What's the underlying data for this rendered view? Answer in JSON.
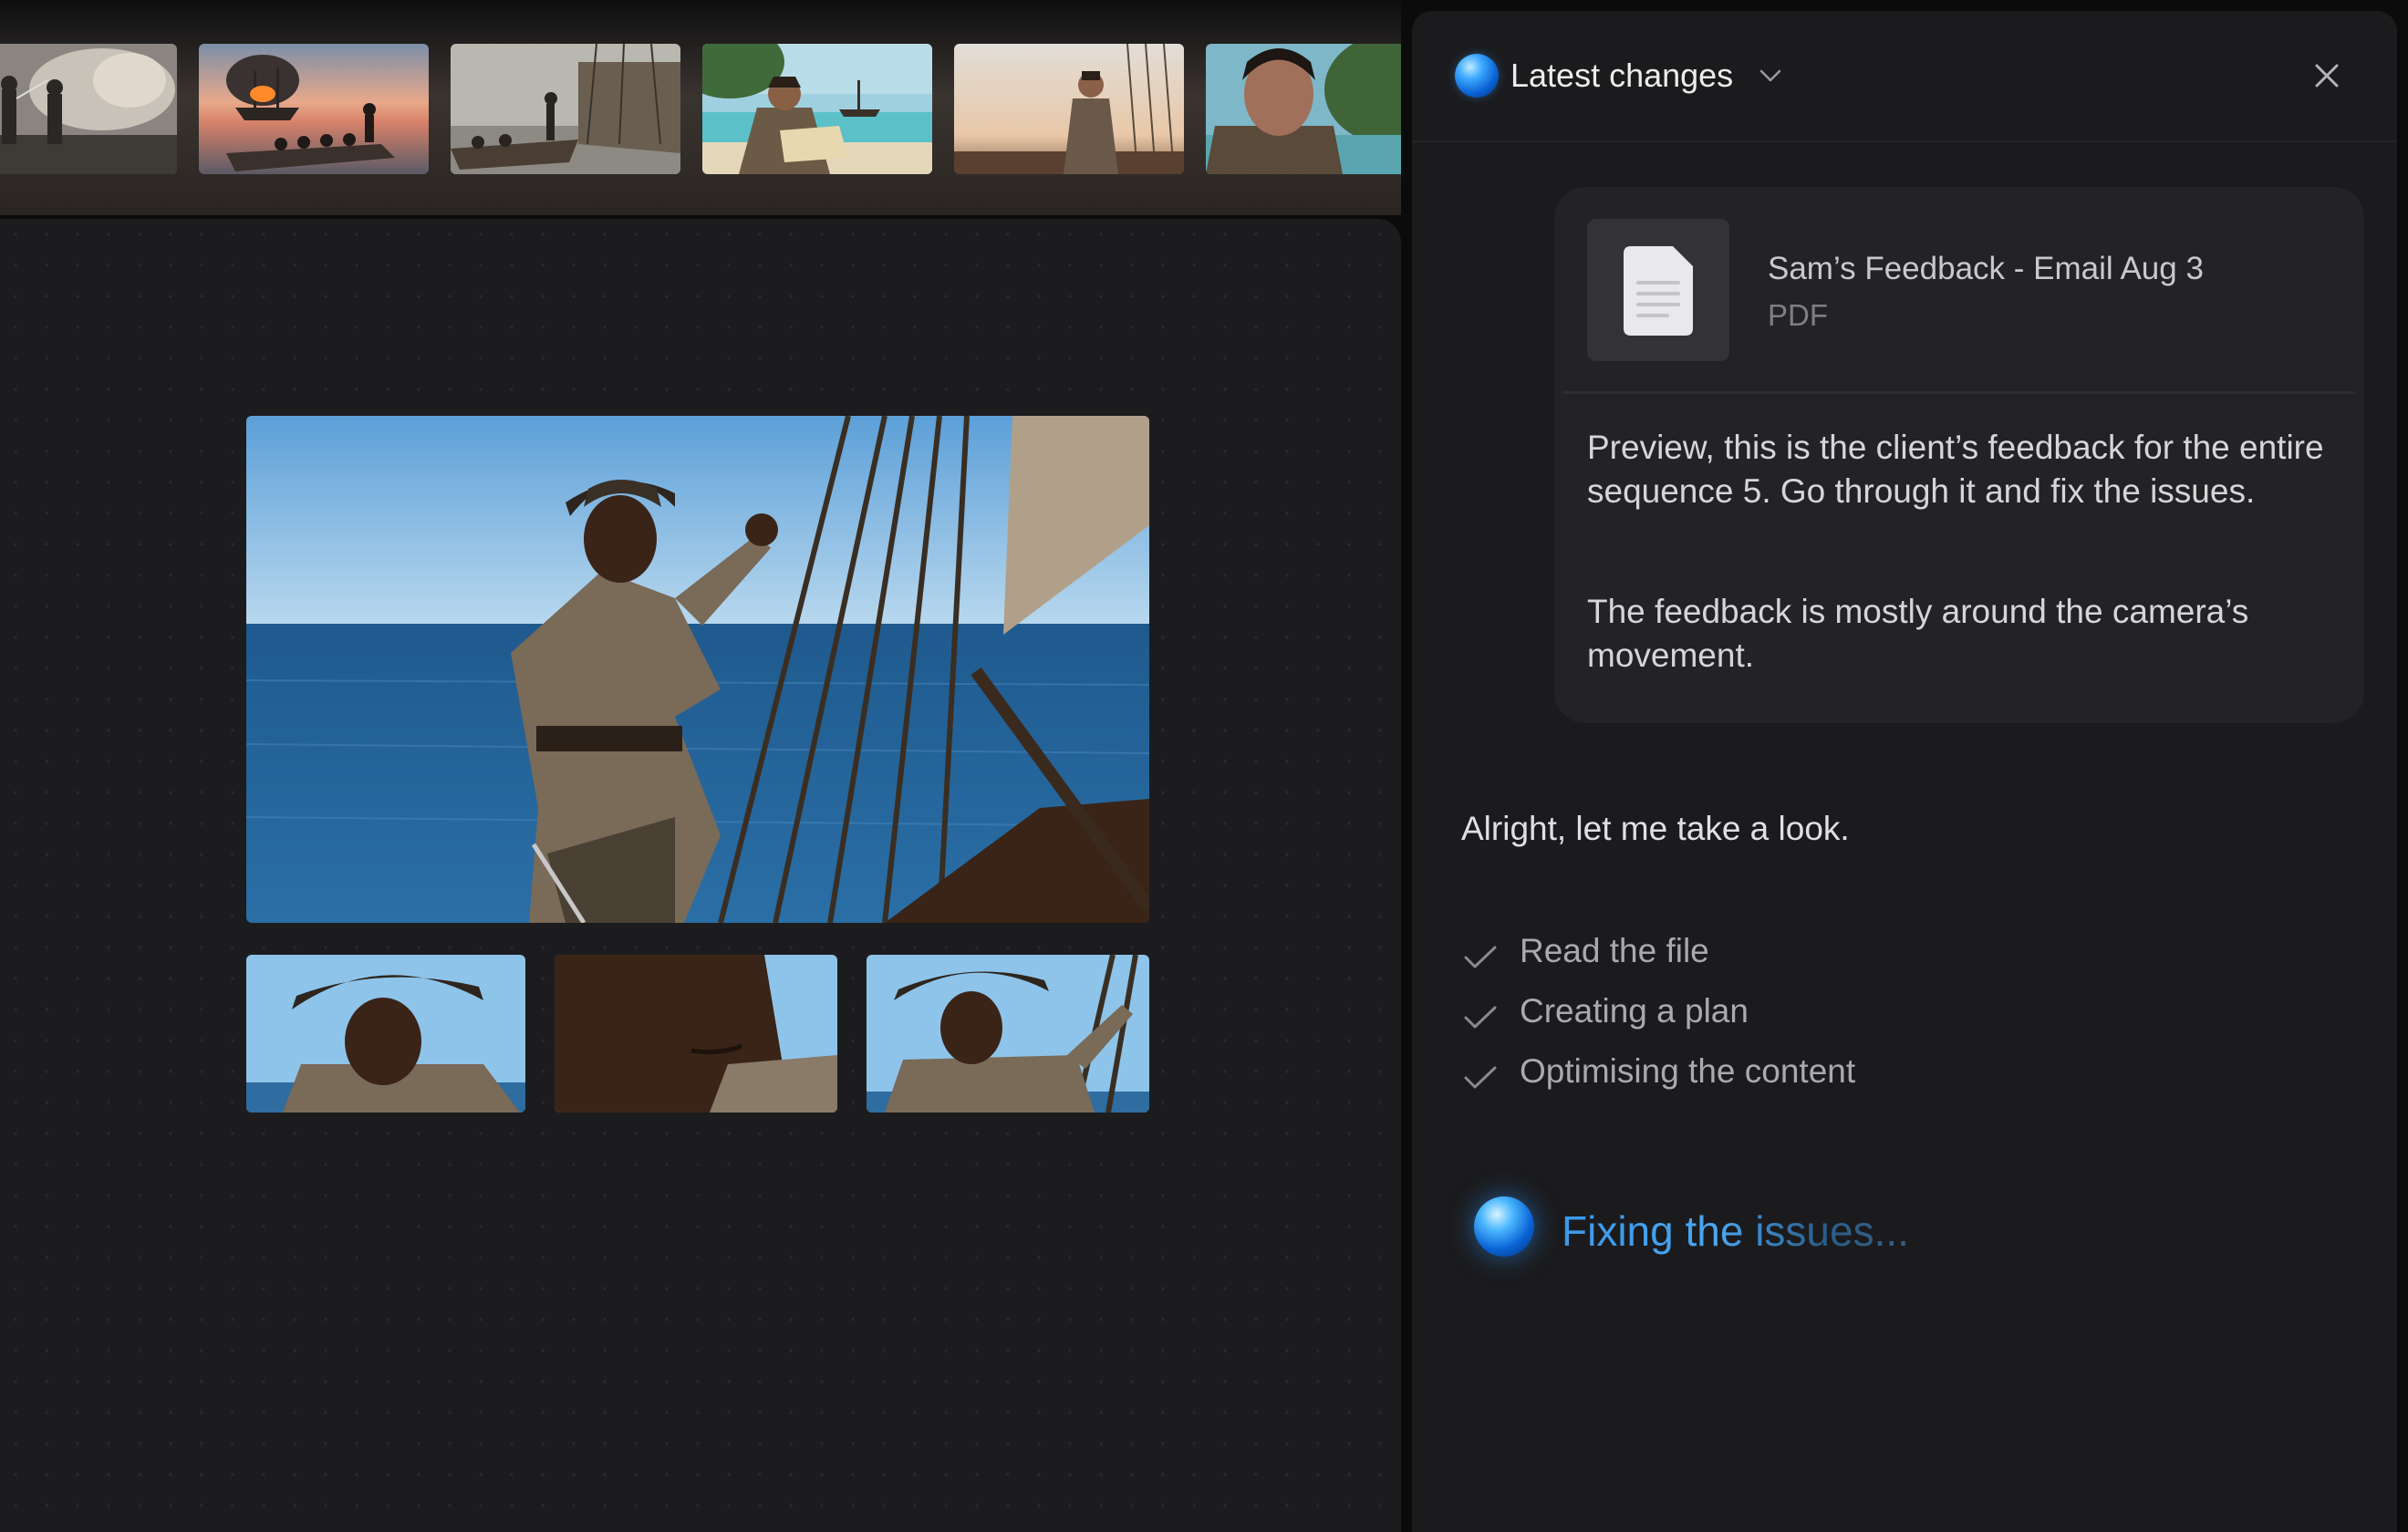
{
  "panel": {
    "title": "Latest changes",
    "attachment": {
      "file_name": "Sam’s Feedback - Email Aug 3",
      "file_type": "PDF"
    },
    "message": {
      "paragraph_1": "Preview, this is the client’s feedback for the entire sequence 5. Go through it and fix the issues.",
      "paragraph_2": "The feedback is mostly around the camera’s movement."
    },
    "reply": "Alright, let me take a look.",
    "steps": [
      {
        "label": "Read the file",
        "done": true
      },
      {
        "label": "Creating a plan",
        "done": true
      },
      {
        "label": "Optimising the content",
        "done": true
      }
    ],
    "status": "Fixing the issues..."
  },
  "timeline": {
    "frames": [
      "sword-fight-smoke",
      "burning-ship-sunset",
      "rowboat-near-ship",
      "map-on-beach",
      "man-on-deck-sunset",
      "man-closeup-island"
    ]
  },
  "canvas": {
    "hero": "pirate-on-ship-rigging",
    "shots": [
      "pirate-medium-shot",
      "pirate-extreme-closeup",
      "pirate-holding-rope"
    ]
  },
  "colors": {
    "panel_bg": "#1b1b1d",
    "card_bg": "#232326",
    "accent_blue": "#3b98e8"
  }
}
